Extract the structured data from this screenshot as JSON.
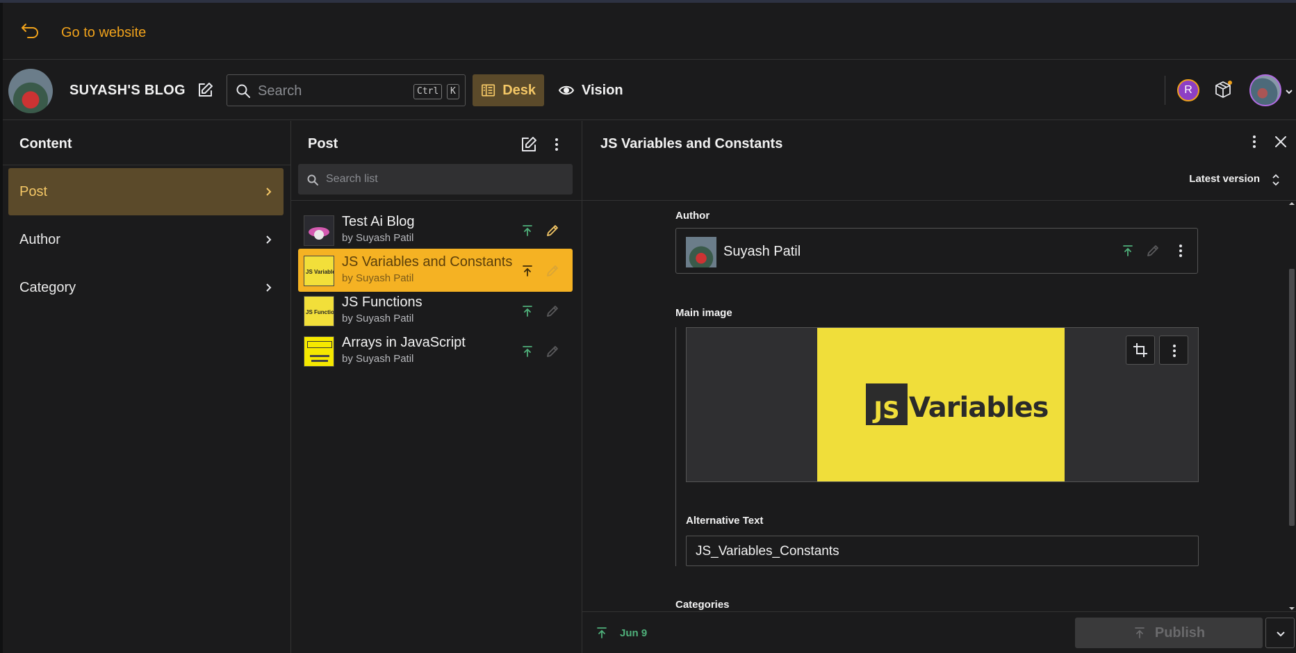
{
  "website_bar": {
    "link_label": "Go to website"
  },
  "navbar": {
    "brand": "SUYASH'S BLOG",
    "search_placeholder": "Search",
    "shortcut_ctrl": "Ctrl",
    "shortcut_key": "K",
    "tools": [
      {
        "label": "Desk"
      },
      {
        "label": "Vision"
      }
    ],
    "user_badge": "R"
  },
  "content_pane": {
    "title": "Content",
    "items": [
      {
        "label": "Post"
      },
      {
        "label": "Author"
      },
      {
        "label": "Category"
      }
    ]
  },
  "list_pane": {
    "title": "Post",
    "search_placeholder": "Search list",
    "documents": [
      {
        "title": "Test Ai Blog",
        "subtitle": "by Suyash Patil"
      },
      {
        "title": "JS Variables and Constants",
        "subtitle": "by Suyash Patil"
      },
      {
        "title": "JS Functions",
        "subtitle": "by Suyash Patil"
      },
      {
        "title": "Arrays in JavaScript",
        "subtitle": "by Suyash Patil"
      }
    ]
  },
  "editor_pane": {
    "title": "JS Variables and Constants",
    "version_label": "Latest version",
    "author_label": "Author",
    "author_name": "Suyash Patil",
    "main_image_label": "Main image",
    "image_text_js": "JS",
    "image_text_word": "Variables",
    "alt_text_label": "Alternative Text",
    "alt_text_value": "JS_Variables_Constants",
    "categories_label": "Categories",
    "footer_date": "Jun 9",
    "publish_label": "Publish"
  },
  "colors": {
    "accent": "#f0a21b",
    "active_item_bg": "#5b4a2a",
    "selected_doc_bg": "#f5b223",
    "published_green": "#4fb07a"
  }
}
